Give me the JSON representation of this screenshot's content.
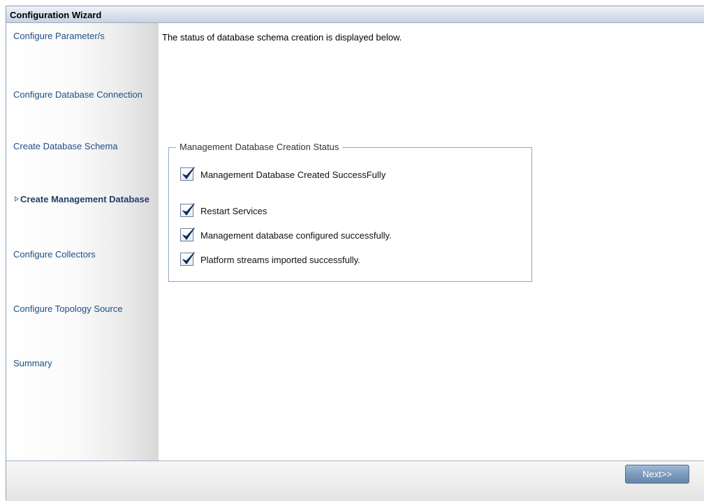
{
  "window": {
    "title": "Configuration Wizard"
  },
  "steps": [
    {
      "label": "Configure Parameter/s",
      "current": false
    },
    {
      "label": "Configure Database Connection",
      "current": false
    },
    {
      "label": "Create Database Schema",
      "current": false
    },
    {
      "label": "Create Management Database",
      "current": true
    },
    {
      "label": "Configure Collectors",
      "current": false
    },
    {
      "label": "Configure Topology Source",
      "current": false
    },
    {
      "label": "Summary",
      "current": false
    }
  ],
  "main": {
    "intro_text": "The status of database schema creation is displayed below.",
    "status_group": {
      "legend": "Management Database Creation Status",
      "items": [
        {
          "label": "Management Database Created SuccessFully",
          "checked": true
        },
        {
          "label": "Restart Services",
          "checked": true
        },
        {
          "label": "Management database configured successfully.",
          "checked": true
        },
        {
          "label": "Platform streams imported successfully.",
          "checked": true
        }
      ]
    }
  },
  "footer": {
    "next_label": "Next>>"
  },
  "colors": {
    "step_link": "#1f4e86",
    "check_mark": "#0c2f57",
    "button": "#7c9abb"
  }
}
